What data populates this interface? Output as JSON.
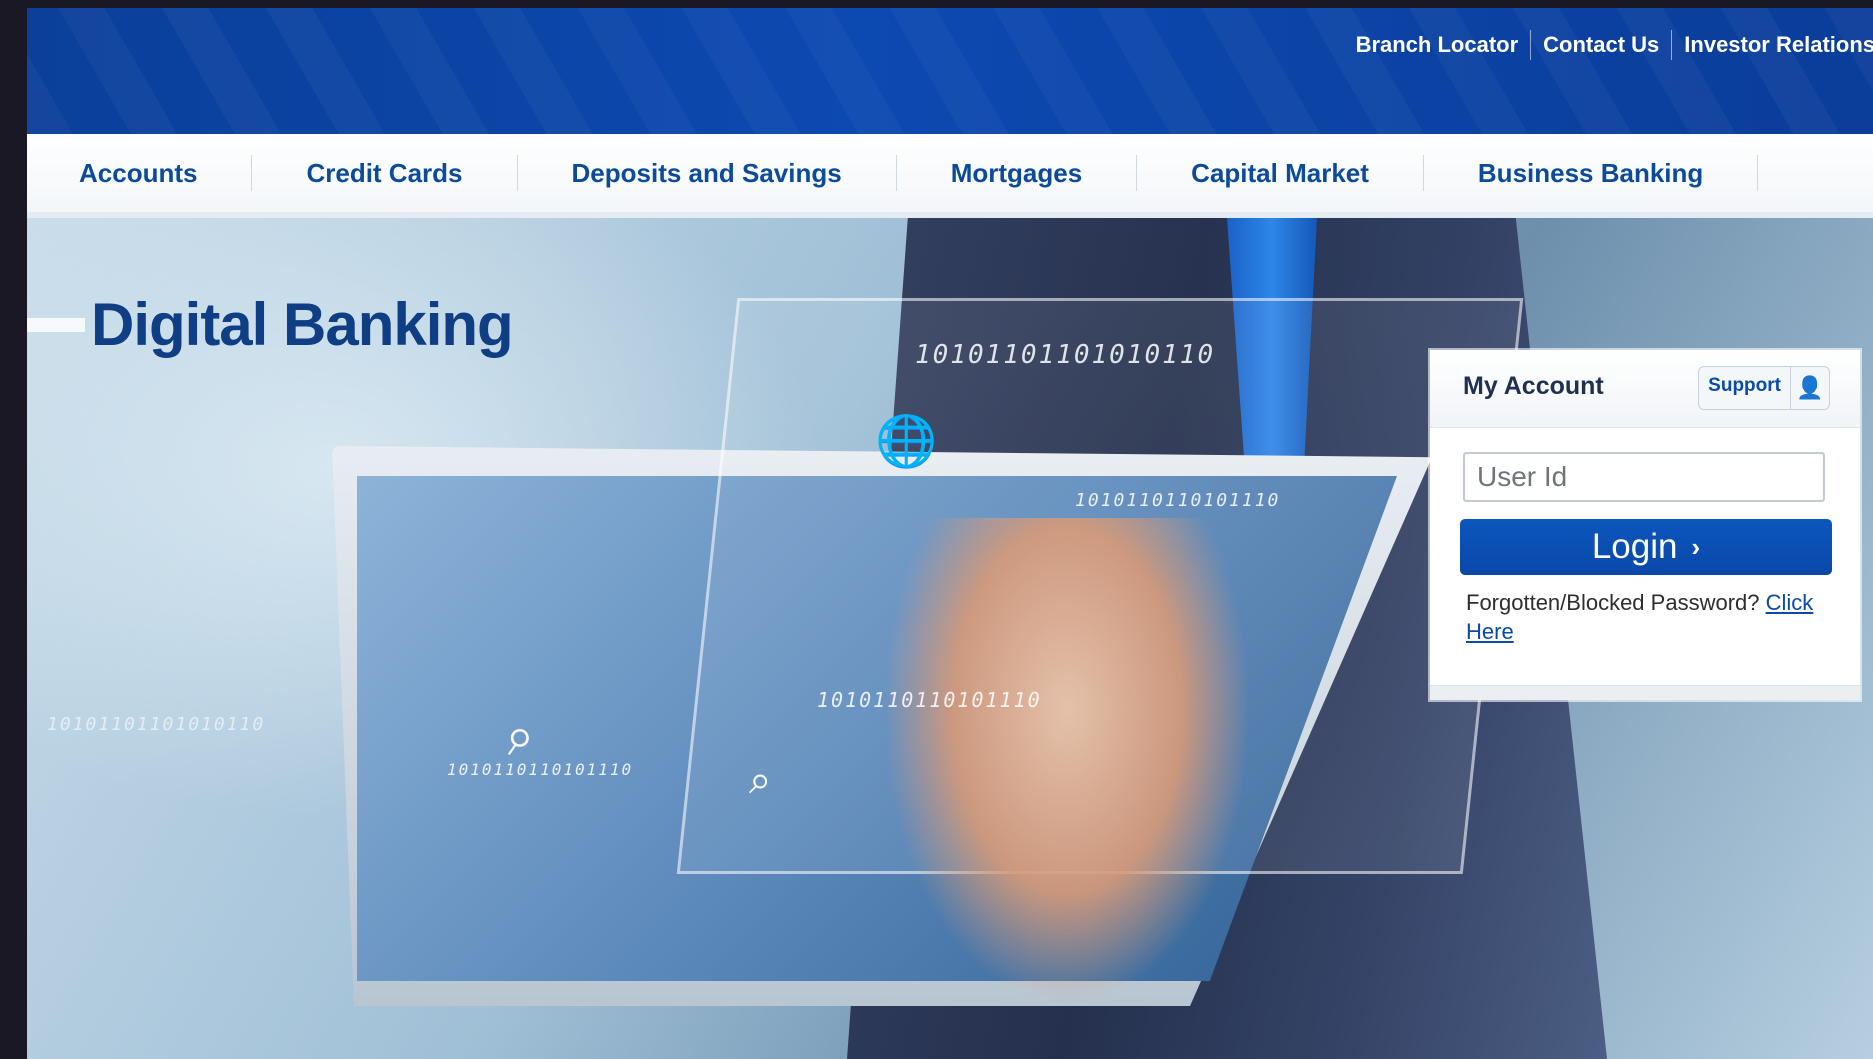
{
  "toplinks": [
    "Branch Locator",
    "Contact Us",
    "Investor Relations"
  ],
  "nav": [
    "Accounts",
    "Credit Cards",
    "Deposits and Savings",
    "Mortgages",
    "Capital Market",
    "Business Banking"
  ],
  "hero": {
    "title": "Digital Banking",
    "binary_a": "10101101101010110",
    "binary_b": "1010110110101110",
    "binary_c": "1010110110101110",
    "binary_d": "10101101101010110",
    "binary_e": "1010110110101110"
  },
  "login": {
    "title": "My Account",
    "support_label": "Support",
    "user_placeholder": "User Id",
    "button_label": "Login",
    "forgot_text": "Forgotten/Blocked Password?",
    "forgot_link": "Click Here"
  },
  "colors": {
    "brand_blue": "#0c49b0",
    "nav_text": "#0c4a9a",
    "button_blue": "#0a48a8"
  }
}
